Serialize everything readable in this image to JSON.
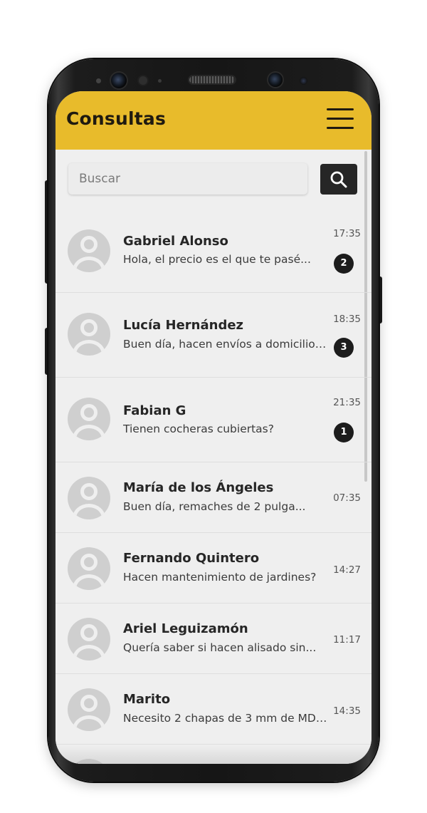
{
  "header": {
    "title": "Consultas",
    "menu_icon": "hamburger-icon"
  },
  "search": {
    "placeholder": "Buscar",
    "button_icon": "search-icon"
  },
  "colors": {
    "header_bg": "#e8bb2b",
    "badge_bg": "#1c1c1c",
    "search_button_bg": "#262626"
  },
  "conversations": [
    {
      "name": "Gabriel Alonso",
      "preview": "Hola, el precio es el que te pasé...",
      "time": "17:35",
      "unread": "2"
    },
    {
      "name": "Lucía Hernández",
      "preview": "Buen día, hacen envíos a domicilio?...",
      "time": "18:35",
      "unread": "3"
    },
    {
      "name": "Fabian G",
      "preview": "Tienen cocheras cubiertas?",
      "time": "21:35",
      "unread": "1"
    },
    {
      "name": "María de los Ángeles",
      "preview": "Buen día, remaches de 2 pulga...",
      "time": "07:35",
      "unread": ""
    },
    {
      "name": "Fernando Quintero",
      "preview": "Hacen mantenimiento de jardines?",
      "time": "14:27",
      "unread": ""
    },
    {
      "name": "Ariel Leguizamón",
      "preview": "Quería saber si hacen alisado sin...",
      "time": "11:17",
      "unread": ""
    },
    {
      "name": "Marito",
      "preview": "Necesito 2 chapas de 3 mm de MDF...",
      "time": "14:35",
      "unread": ""
    }
  ]
}
